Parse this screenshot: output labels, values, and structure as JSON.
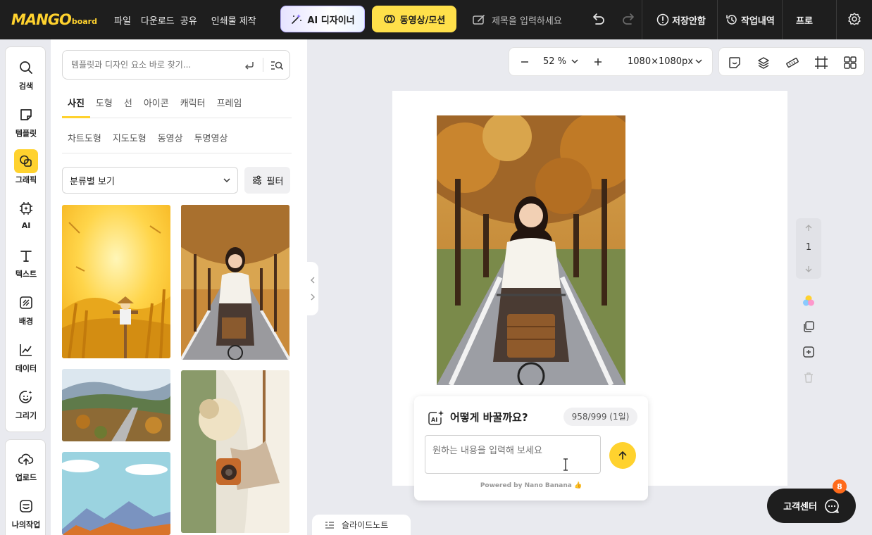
{
  "brand": {
    "wordmark": "MANGO",
    "wordmark_sub": "board",
    "accent": "#ffd22e"
  },
  "topbar": {
    "menus": [
      "파일",
      "다운로드",
      "공유",
      "인쇄물 제작"
    ],
    "ai_designer": "AI 디자이너",
    "video_motion": "동영상/모션",
    "title_placeholder": "제목을 입력하세요",
    "save_status": "저장안함",
    "history": "작업내역",
    "pro": "프로"
  },
  "rail": {
    "items": [
      "검색",
      "템플릿",
      "그래픽",
      "AI",
      "텍스트",
      "배경",
      "데이터",
      "그리기"
    ],
    "active": "그래픽",
    "bottom_items": [
      "업로드",
      "나의작업"
    ]
  },
  "panel": {
    "search_placeholder": "템플릿과 디자인 요소 바로 찾기...",
    "tabs": [
      "사진",
      "도형",
      "선",
      "아이콘",
      "캐릭터",
      "프레임"
    ],
    "active_tab": "사진",
    "subtabs": [
      "차트도형",
      "지도도형",
      "동영상",
      "투명영상"
    ],
    "category_select": "분류별 보기",
    "filter": "필터"
  },
  "canvas": {
    "zoom": "52 %",
    "size": "1080×1080px",
    "page_number": "1"
  },
  "ai_prompt": {
    "title": "어떻게 바꿀까요?",
    "usage": "958/999 (1일)",
    "input_placeholder": "원하는 내용을 입력해 보세요",
    "powered": "Powered by Nano Banana 👍"
  },
  "slide_notes": "슬라이드노트",
  "help": {
    "label": "고객센터",
    "badge": "8"
  }
}
